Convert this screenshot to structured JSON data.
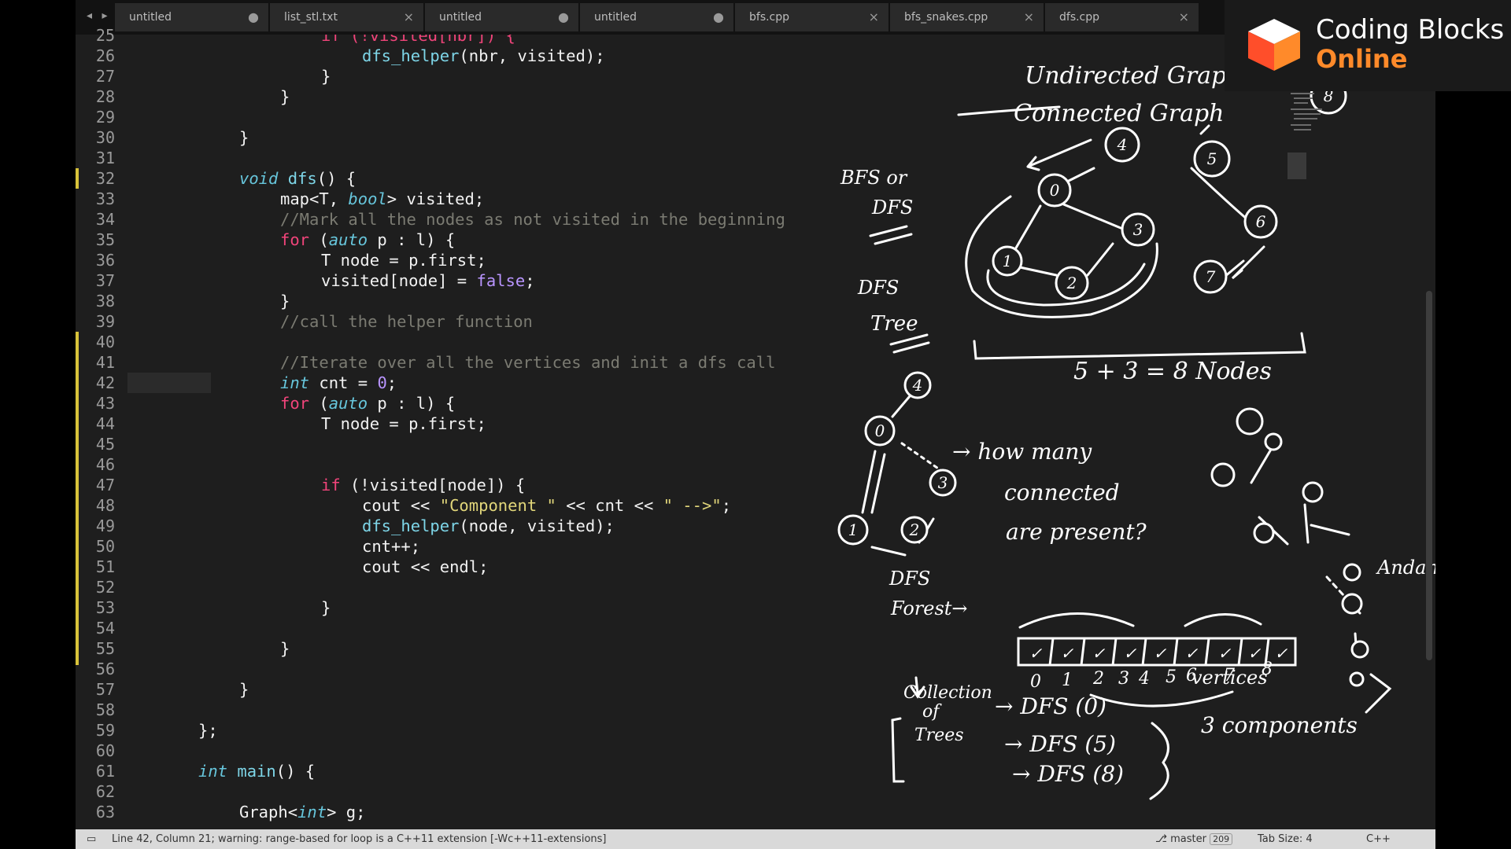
{
  "tabs": {
    "nav": "◂ ▸",
    "items": [
      {
        "label": "untitled",
        "ctl": "●"
      },
      {
        "label": "list_stl.txt",
        "ctl": "×"
      },
      {
        "label": "untitled",
        "ctl": "●"
      },
      {
        "label": "untitled",
        "ctl": "●"
      },
      {
        "label": "bfs.cpp",
        "ctl": "×"
      },
      {
        "label": "bfs_snakes.cpp",
        "ctl": "×"
      },
      {
        "label": "dfs.cpp",
        "ctl": "×"
      }
    ]
  },
  "editor": {
    "line_numbers": [
      "25",
      "26",
      "27",
      "28",
      "29",
      "30",
      "31",
      "32",
      "33",
      "34",
      "35",
      "36",
      "37",
      "38",
      "39",
      "40",
      "41",
      "42",
      "43",
      "44",
      "45",
      "46",
      "47",
      "48",
      "49",
      "50",
      "51",
      "52",
      "53",
      "54",
      "55",
      "56",
      "57",
      "58",
      "59",
      "60",
      "61",
      "62",
      "63"
    ]
  },
  "code": {
    "l25a": "if (!visited[nbr]) {",
    "l26a": "dfs_helper",
    "l26b": "(nbr, visited);",
    "l27": "}",
    "l28": "}",
    "l30": "}",
    "l32a": "void",
    "l32b": "dfs",
    "l32c": "() {",
    "l33a": "map<T, ",
    "l33b": "bool",
    "l33c": "> visited;",
    "l34": "//Mark all the nodes as not visited in the beginning",
    "l35a": "for",
    "l35b": " (",
    "l35c": "auto",
    "l35d": " p : l) {",
    "l36": "T node = p.first;",
    "l37a": "visited[node] = ",
    "l37b": "false",
    "l37c": ";",
    "l38": "}",
    "l39": "//call the helper function",
    "l41": "//Iterate over all the vertices and init a dfs call",
    "l42a": "int",
    "l42b": " cnt = ",
    "l42c": "0",
    "l42d": ";",
    "l43a": "for",
    "l43b": " (",
    "l43c": "auto",
    "l43d": " p : l) {",
    "l44": "T node = p.first;",
    "l47a": "if",
    "l47b": " (!visited[node]) {",
    "l48a": "cout << ",
    "l48b": "\"Component \"",
    "l48c": " << cnt << ",
    "l48d": "\" -->\"",
    "l48e": ";",
    "l49a": "dfs_helper",
    "l49b": "(node, visited);",
    "l50": "cnt++;",
    "l51": "cout << endl;",
    "l53": "}",
    "l55": "}",
    "l57": "}",
    "l59": "};",
    "l61a": "int",
    "l61b": " ",
    "l61c": "main",
    "l61d": "() {",
    "l63a": "Graph<",
    "l63b": "int",
    "l63c": "> g;"
  },
  "whiteboard": {
    "title1": "Undirected Graph",
    "title2": "Connected Graph",
    "bfs_or": "BFS or",
    "dfs": "DFS",
    "dfs_tree_1": "DFS",
    "dfs_tree_2": "Tree",
    "nodes_eq": "5 + 3 = 8 Nodes",
    "how_many": "→ how many",
    "connected": "connected",
    "are_present": "are present?",
    "dfs_forest_1": "DFS",
    "dfs_forest_2": "Forest→",
    "collection_1": "Collection",
    "collection_2": "of",
    "collection_3": "Trees",
    "dfs0": "→ DFS (0)",
    "dfs5": "→ DFS (5)",
    "dfs8": "→ DFS (8)",
    "components": "3 components",
    "vertices": "vertices",
    "andaman": "Andaman",
    "array_marks": [
      "✓",
      "✓",
      "✓",
      "✓",
      "✓",
      "✓",
      "✓",
      "✓",
      "✓"
    ],
    "array_index": [
      "0",
      "1",
      "2",
      "3",
      "4",
      "5",
      "6",
      "7",
      "8"
    ],
    "g1_nodes": [
      "0",
      "1",
      "2",
      "3",
      "4"
    ],
    "g2_nodes": [
      "5",
      "6",
      "7"
    ],
    "g3_node": "8",
    "tree_nodes": [
      "0",
      "1",
      "2",
      "3",
      "4"
    ]
  },
  "logo": {
    "line1": "Coding Blocks",
    "line2": "Online"
  },
  "status": {
    "message": "Line 42, Column 21; warning: range-based for loop is a C++11 extension [-Wc++11-extensions]",
    "branch": "master",
    "branch_count": "209",
    "tab_size": "Tab Size: 4",
    "syntax": "C++"
  }
}
